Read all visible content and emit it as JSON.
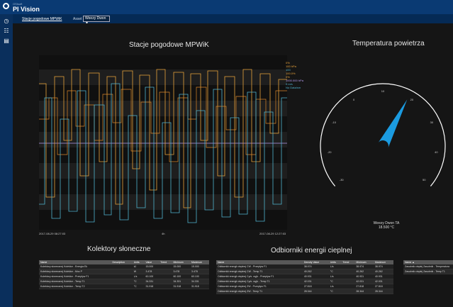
{
  "app": {
    "brand_small": "OSIsoft",
    "title": "PI Vision"
  },
  "subbar": {
    "breadcrumb": "Stacje pogodowe MPWiK",
    "asset_label": "Asset",
    "asset_value": "Weezy Dwon ▼"
  },
  "panels": {
    "trend_title": "Stacje pogodowe MPWiK",
    "gauge_title": "Temperatura powietrza",
    "solar_title": "Kolektory słoneczne",
    "heat_title": "Odbiorniki energii cieplnej"
  },
  "trend": {
    "top_legend": [
      "1000",
      "0.5",
      "100",
      "0"
    ],
    "right_legend": [
      {
        "text": "0%",
        "color": "#e8a33b"
      },
      {
        "text": "100 hPa",
        "color": "#e8a33b"
      },
      {
        "text": "100",
        "color": "#4fb3cf"
      },
      {
        "text": "100.0%",
        "color": "#e8a33b"
      },
      {
        "text": "0%",
        "color": "#e8a33b"
      },
      {
        "text": "1000.000 hPa",
        "color": "#b59cf0"
      },
      {
        "text": "0 m/s",
        "color": "#4fb3cf"
      },
      {
        "text": "No Data/sm",
        "color": "#4fb3cf"
      }
    ],
    "x_start": "2017-08-29 08:27:03",
    "x_mid": "4h",
    "x_end": "2017-08-29 12:27:03"
  },
  "gauge": {
    "ticks": [
      "-30",
      "-20",
      "-10",
      "0",
      "10",
      "20",
      "30",
      "40",
      "50"
    ],
    "ticks_right": [
      "50",
      "40",
      "30",
      "20",
      "10",
      "0",
      "-10",
      "-20",
      "-30"
    ],
    "caption_name": "Weezy Dwon TA",
    "caption_value": "18.500 °C",
    "value": 18.5,
    "color": "#1b9be0"
  },
  "solar_table": {
    "headers": [
      "Name",
      "Description",
      "Units",
      "Value",
      "Trend",
      "Minimum",
      "Maximum"
    ],
    "rows": [
      [
        "Kolektory słonecznej Kolektor - Energia Ek",
        "",
        "kJ",
        "15.000",
        "",
        "15.000",
        "15.000"
      ],
      [
        "Kolektory słonecznej Kolektor - Moc P",
        "",
        "W",
        "3.478",
        "",
        "3.478",
        "3.478"
      ],
      [
        "Kolektory słonecznej Kolektor - Przepływ F1",
        "",
        "L/s",
        "60.100",
        "",
        "60.100",
        "60.100"
      ],
      [
        "Kolektory słonecznej Kolektor - Temp T1",
        "",
        "°C",
        "34.331",
        "",
        "34.331",
        "34.331"
      ],
      [
        "Kolektory słonecznej Kolektor - Temp T2",
        "",
        "°C",
        "31.918",
        "",
        "31.918",
        "31.918"
      ]
    ]
  },
  "heat_table": {
    "headers": [
      "Name",
      "Density Value",
      "Units",
      "Trend",
      "Minimum",
      "Maximum"
    ],
    "rows": [
      [
        "Odbiorniki energii cieplnej CW - Przepływ F1",
        "38.974",
        "L/s",
        "",
        "38.974",
        "38.974"
      ],
      [
        "Odbiorniki energii cieplnej CW - Temp T1",
        "40.262",
        "°C",
        "",
        "40.262",
        "40.262"
      ],
      [
        "Odbiorniki energii cieplnej Cyrk. wyjś - Przepływ F1",
        "40.931",
        "L/s",
        "",
        "40.931",
        "40.931"
      ],
      [
        "Odbiorniki energii cieplnej Cyrk. wyjś - Temp T1",
        "42.031",
        "°C",
        "",
        "42.031",
        "42.031"
      ],
      [
        "Odbiorniki energii cieplnej ZW - Przepływ F1",
        "27.818",
        "L/s",
        "",
        "27.818",
        "27.818"
      ],
      [
        "Odbiorniki energii cieplnej ZW - Temp T1",
        "28.344",
        "°C",
        "",
        "28.344",
        "28.344"
      ]
    ]
  },
  "attr_table": {
    "headers": [
      "Name ▲"
    ],
    "rows": [
      [
        "Zasobnik ciepłej Zasobnik - Temperatura"
      ],
      [
        "Zasobnik ciepłej Zasobnik - Temp T1"
      ]
    ]
  }
}
